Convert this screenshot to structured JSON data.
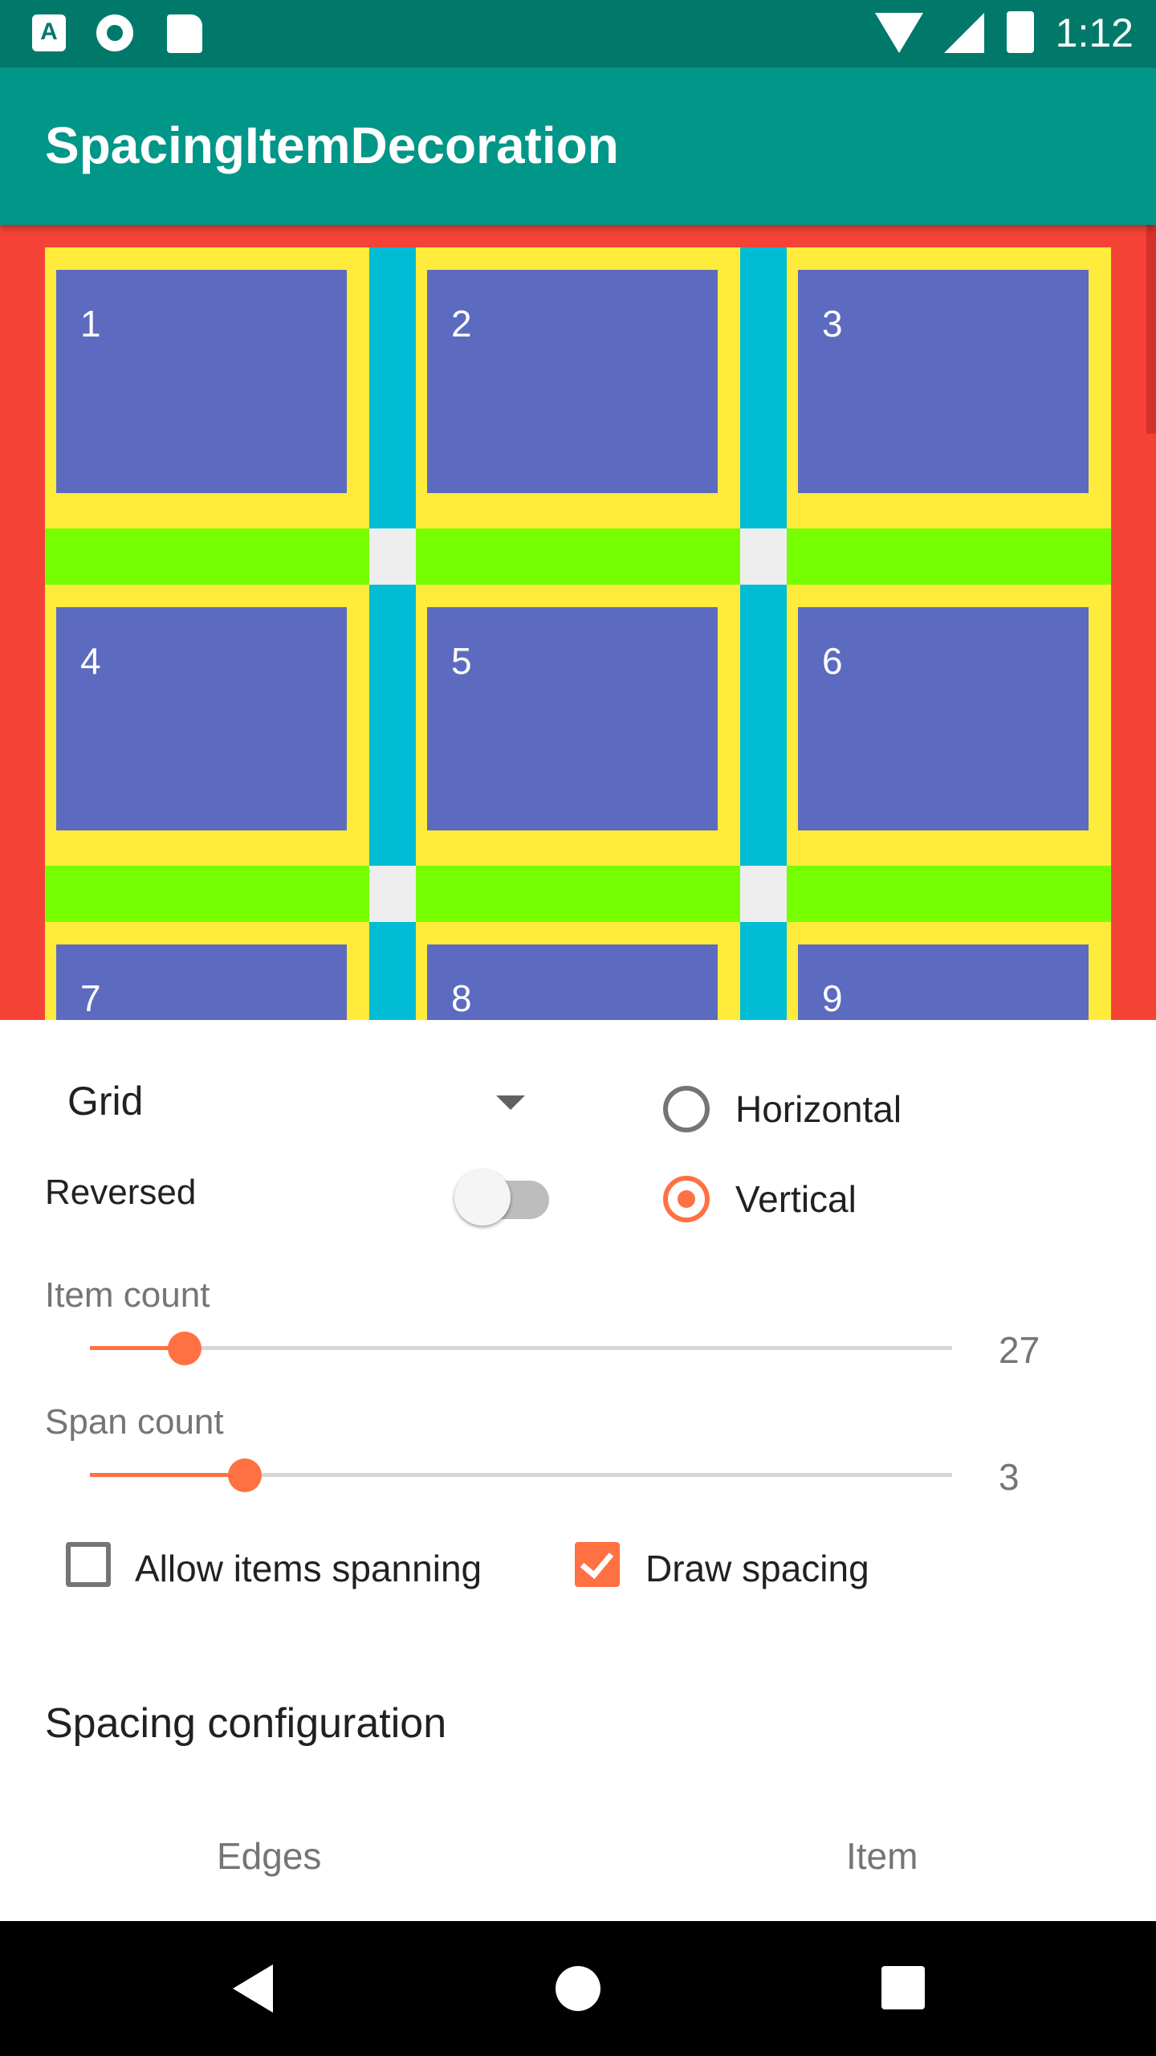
{
  "status_bar": {
    "time": "1:12",
    "icons": [
      "a-icon",
      "circle-icon",
      "sd-card-icon",
      "wifi-icon",
      "signal-icon",
      "battery-icon"
    ]
  },
  "app_bar": {
    "title": "SpacingItemDecoration"
  },
  "grid": {
    "items": [
      "1",
      "2",
      "3",
      "4",
      "5",
      "6",
      "7",
      "8",
      "9"
    ]
  },
  "controls": {
    "layout_dropdown": {
      "value": "Grid"
    },
    "orientation": {
      "horizontal_label": "Horizontal",
      "vertical_label": "Vertical",
      "selected": "Vertical"
    },
    "reversed": {
      "label": "Reversed",
      "checked": false
    },
    "item_count": {
      "label": "Item count",
      "value": "27",
      "fraction": 0.11
    },
    "span_count": {
      "label": "Span count",
      "value": "3",
      "fraction": 0.18
    },
    "allow_spanning": {
      "label": "Allow items spanning",
      "checked": false
    },
    "draw_spacing": {
      "label": "Draw spacing",
      "checked": true
    },
    "section_title": "Spacing configuration",
    "tabs": [
      "Edges",
      "Item"
    ]
  },
  "colors": {
    "accent": "#FF7043",
    "primary": "#009688",
    "primary_dark": "#00796B",
    "edge_spacing": "#F44336",
    "item_padding": "#FFEB3B",
    "item": "#5C6BC0",
    "horizontal_spacing": "#00BCD4",
    "vertical_spacing": "#76FF03"
  }
}
